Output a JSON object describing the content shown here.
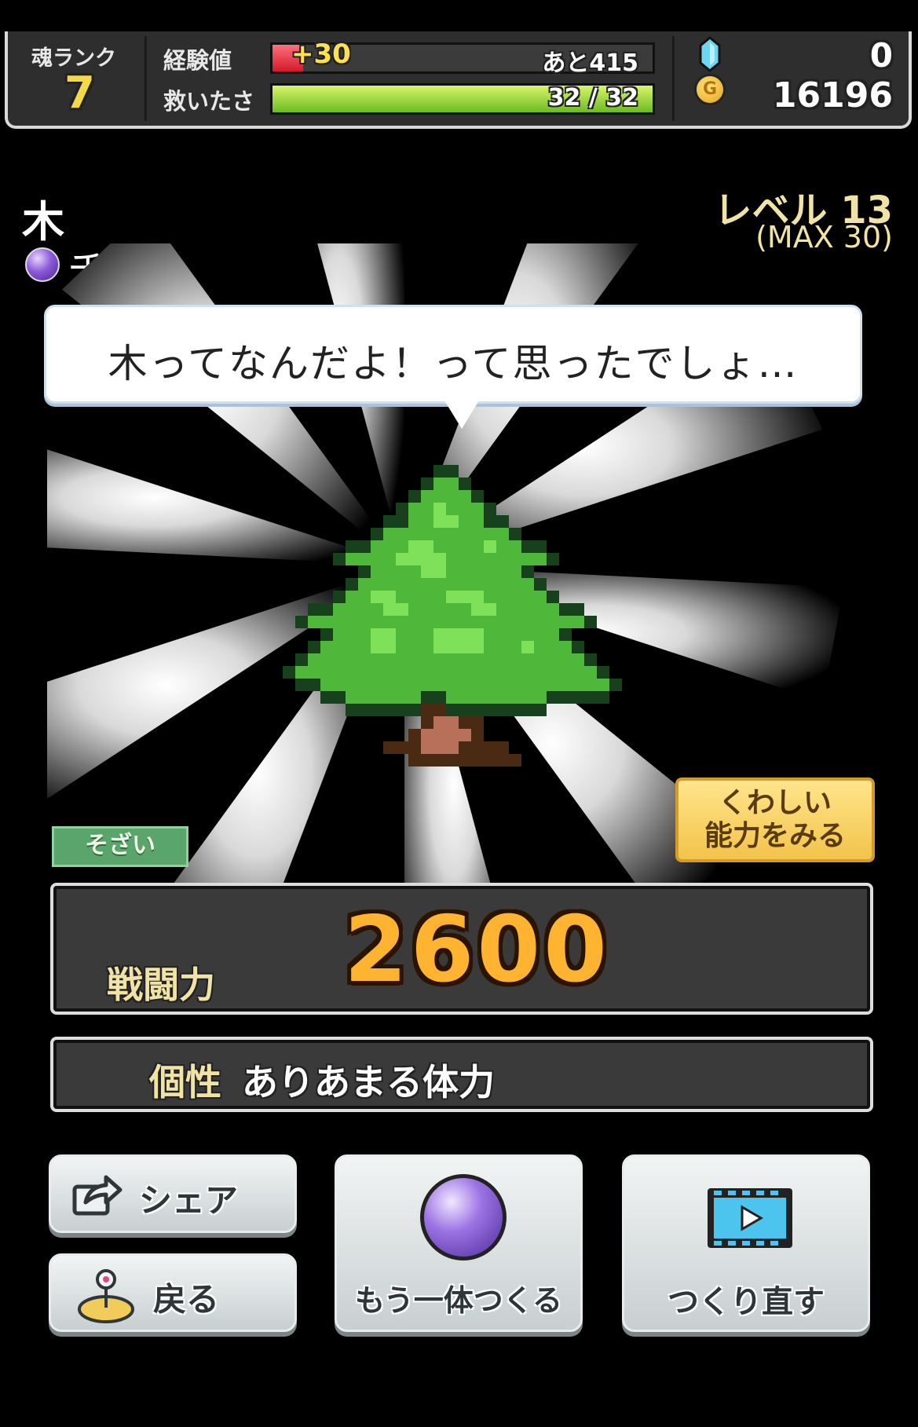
{
  "status": {
    "rank_label": "魂ランク",
    "rank_value": "7",
    "exp_label": "経験値",
    "exp_gain": "+30",
    "exp_remaining": "あと415",
    "exp_progress": 0.08,
    "rescued_label": "救いたさ",
    "rescued_value": "32 / 32",
    "rescued_progress": 1.0,
    "gems": "0",
    "gold": "16196",
    "coin_letter": "G"
  },
  "character": {
    "name": "木",
    "creator": "チゲン",
    "level": "レベル 13",
    "level_max": "(MAX 30)",
    "speech": "木ってなんだよ！って思ったでしょ…"
  },
  "tags": {
    "material": "そざい",
    "details_line1": "くわしい",
    "details_line2": "能力をみる"
  },
  "stats": {
    "power_label": "戦闘力",
    "power_value": "2600",
    "trait_label": "個性",
    "trait_value": "ありあまる体力"
  },
  "buttons": {
    "share": "シェア",
    "back": "戻る",
    "make_another": "もう一体つくる",
    "remake": "つくり直す"
  },
  "colors": {
    "accent_gold": "#f1e3a6",
    "power_orange": "#ffb431",
    "hp_green": "#6dbb24",
    "exp_red": "#d21a2c",
    "material_green": "#5aa56b"
  }
}
